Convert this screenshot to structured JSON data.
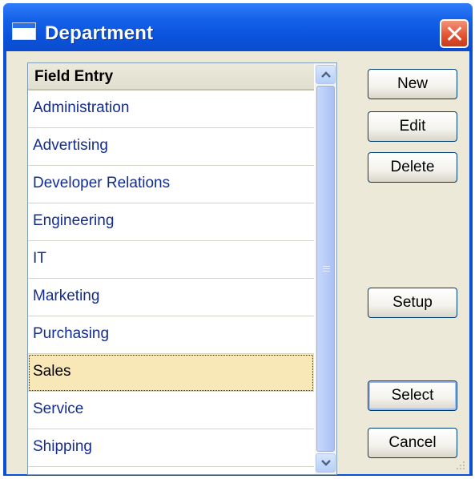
{
  "window": {
    "title": "Department"
  },
  "list": {
    "header": "Field Entry",
    "items": [
      {
        "label": "Administration"
      },
      {
        "label": "Advertising"
      },
      {
        "label": "Developer Relations"
      },
      {
        "label": "Engineering"
      },
      {
        "label": "IT"
      },
      {
        "label": "Marketing"
      },
      {
        "label": "Purchasing"
      },
      {
        "label": "Sales",
        "selected": true
      },
      {
        "label": "Service"
      },
      {
        "label": "Shipping"
      }
    ],
    "selected_item": "Sales"
  },
  "buttons": {
    "new_label": "New",
    "edit_label": "Edit",
    "delete_label": "Delete",
    "setup_label": "Setup",
    "select_label": "Select",
    "cancel_label": "Cancel"
  },
  "colors": {
    "title_bar": "#0a53dc",
    "selection_highlight": "#f8e8b8",
    "item_text": "#132c8f",
    "dialog_background": "#ece9d8"
  },
  "icons": {
    "title": "window-icon",
    "close": "close-icon",
    "scroll_up": "chevron-up-icon",
    "scroll_down": "chevron-down-icon"
  }
}
